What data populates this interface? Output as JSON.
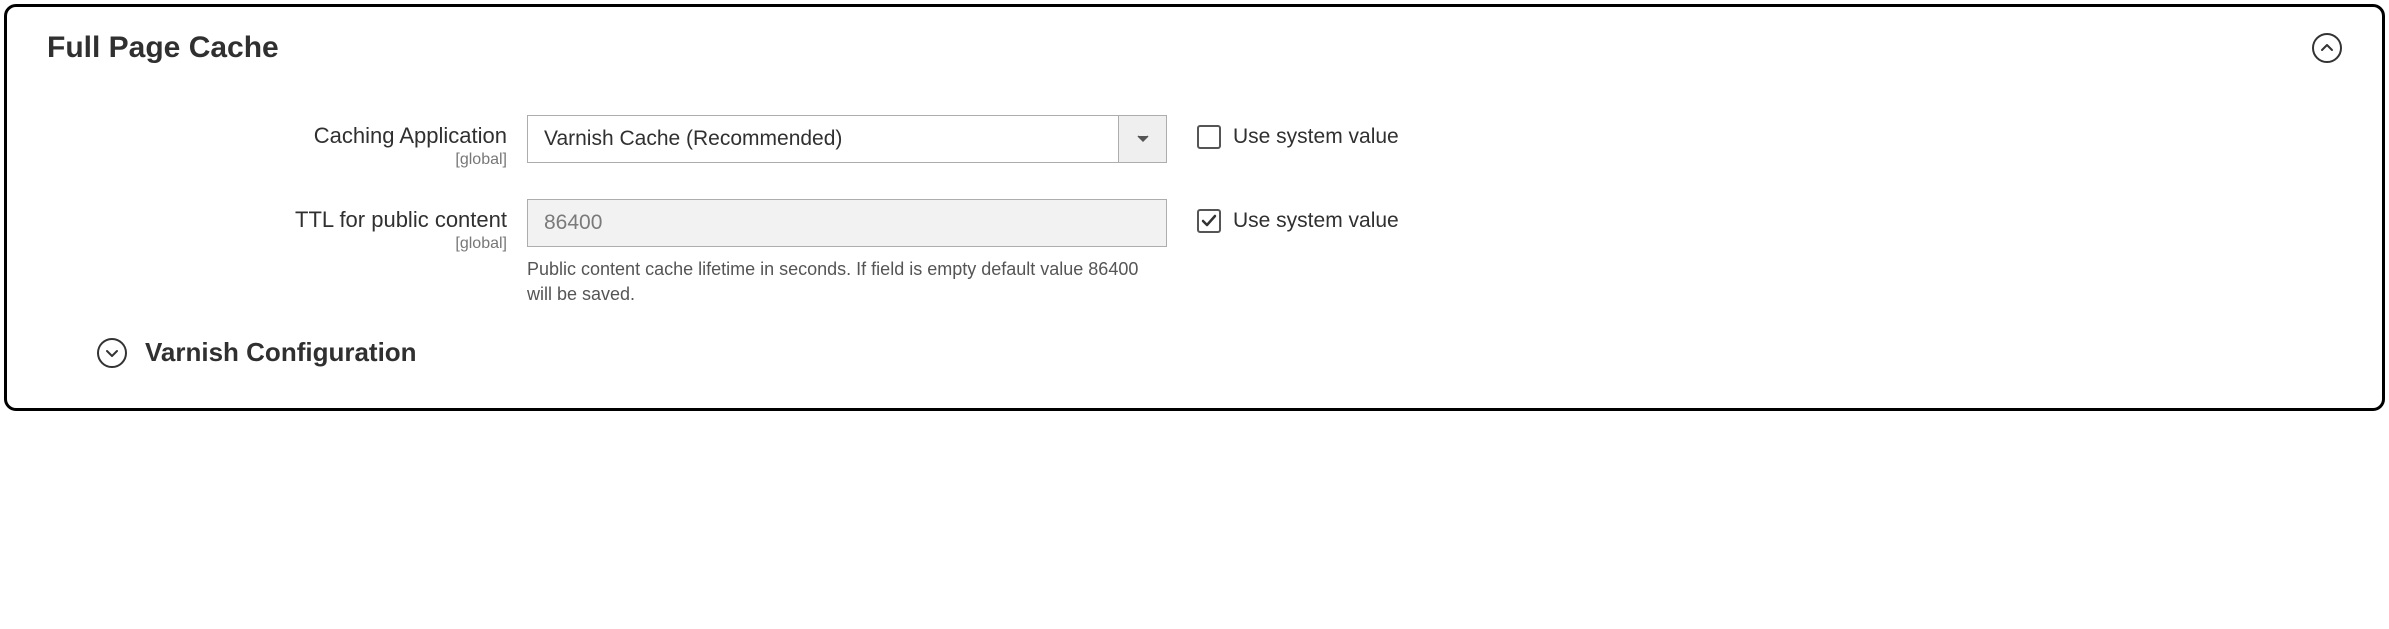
{
  "panel": {
    "title": "Full Page Cache"
  },
  "fields": {
    "caching_application": {
      "label": "Caching Application",
      "scope": "[global]",
      "value": "Varnish Cache (Recommended)",
      "use_system_label": "Use system value",
      "use_system_checked": false
    },
    "ttl": {
      "label": "TTL for public content",
      "scope": "[global]",
      "value": "86400",
      "help": "Public content cache lifetime in seconds. If field is empty default value 86400 will be saved.",
      "use_system_label": "Use system value",
      "use_system_checked": true
    }
  },
  "subsection": {
    "title": "Varnish Configuration"
  }
}
